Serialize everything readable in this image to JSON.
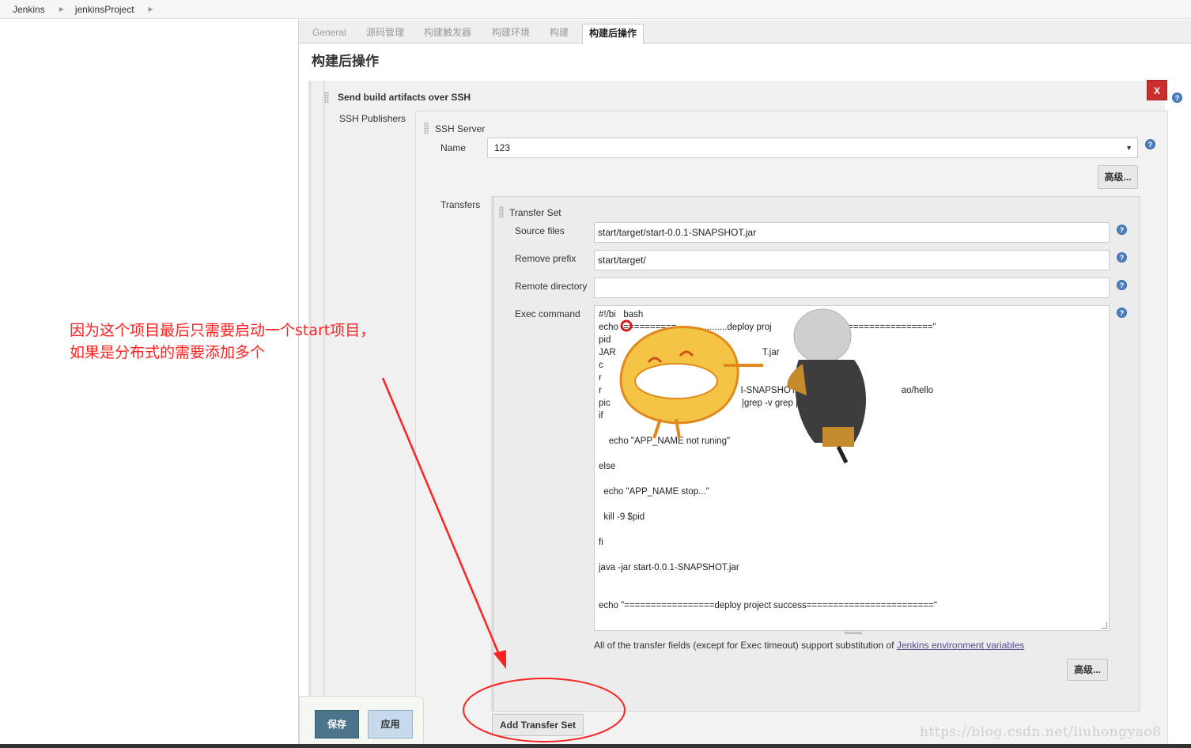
{
  "breadcrumb": {
    "items": [
      "Jenkins",
      "jenkinsProject"
    ]
  },
  "tabs": [
    "General",
    "源码管理",
    "构建触发器",
    "构建环境",
    "构建",
    "构建后操作"
  ],
  "section_title": "构建后操作",
  "publisher": {
    "title": "Send build artifacts over SSH",
    "delete_label": "X",
    "ssh_publishers_label": "SSH Publishers",
    "ssh_server_label": "SSH Server",
    "name_label": "Name",
    "name_value": "123",
    "advanced_label": "高级...",
    "transfers_label": "Transfers",
    "transfer_set_label": "Transfer Set",
    "source_files_label": "Source files",
    "source_files_value": "start/target/start-0.0.1-SNAPSHOT.jar",
    "remove_prefix_label": "Remove prefix",
    "remove_prefix_value": "start/target/",
    "remote_directory_label": "Remote directory",
    "remote_directory_value": "",
    "exec_command_label": "Exec command",
    "exec_command_lines": [
      "#!/bi   bash",
      "echo  ==========        ............deploy proj                          ==================\"",
      "pid",
      "JAR                                                          T.jar",
      "c",
      "r",
      "r                                                       I-SNAPSHOT.jar                                     ao/hello",
      "pic                                                    |grep -v grep |awk '{prin",
      "if",
      "    echo \"APP_NAME not runing\"",
      "else",
      "  echo \"APP_NAME stop...\"",
      "  kill -9 $pid",
      "fi",
      "java -jar start-0.0.1-SNAPSHOT.jar",
      "echo \"=================deploy project success========================\""
    ],
    "note_text": "All of the transfer fields (except for Exec timeout) support substitution of ",
    "note_link": "Jenkins environment variables",
    "advanced2_label": "高级...",
    "add_transfer_set_label": "Add Transfer Set",
    "help_glyph": "?"
  },
  "buttons": {
    "save": "保存",
    "apply": "应用"
  },
  "annotation": {
    "line1": "因为这个项目最后只需要启动一个start项目，",
    "line2": "如果是分布式的需要添加多个"
  },
  "watermark": "https://blog.csdn.net/liuhongyao8",
  "colors": {
    "annotation": "#ff2020",
    "save_button": "#4b758b",
    "apply_button": "#c7d9ec",
    "delete_button": "#c9302c"
  }
}
